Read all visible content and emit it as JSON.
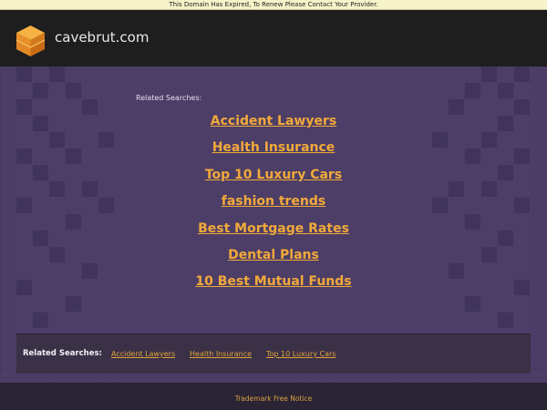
{
  "notice": {
    "text": "This Domain Has Expired, To Renew Please Contact Your Provider."
  },
  "header": {
    "domain": "cavebrut.com",
    "logo_icon": "stacked-cube-logo-icon"
  },
  "related": {
    "title": "Related Searches:",
    "links": [
      "Accident Lawyers",
      "Health Insurance",
      "Top 10 Luxury Cars",
      "fashion trends",
      "Best Mortgage Rates",
      "Dental Plans",
      "10 Best Mutual Funds"
    ]
  },
  "bottom": {
    "label": "Related Searches:",
    "links": [
      "Accident Lawyers",
      "Health Insurance",
      "Top 10 Luxury Cars"
    ]
  },
  "footer": {
    "trademark": "Trademark Free Notice"
  },
  "colors": {
    "accent": "#f2a93b",
    "header_bg": "#1e1e1e",
    "page_bg": "#4a3b63",
    "notice_bg": "#f7f3c9"
  }
}
